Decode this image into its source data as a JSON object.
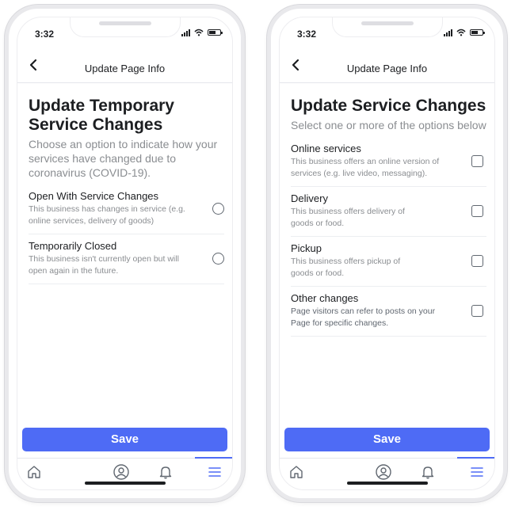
{
  "status": {
    "time": "3:32"
  },
  "header": {
    "title": "Update Page Info"
  },
  "left": {
    "title": "Update Temporary Service Changes",
    "subtitle": "Choose an option to indicate how your services have changed due to coronavirus (COVID-19).",
    "options": [
      {
        "title": "Open With Service Changes",
        "desc": "This business has changes in service (e.g. online services, delivery of goods)"
      },
      {
        "title": "Temporarily Closed",
        "desc": "This business isn't currently open but will open again in the future."
      }
    ]
  },
  "right": {
    "title": "Update Service Changes",
    "subtitle": "Select one or more of the options below",
    "options": [
      {
        "title": "Online services",
        "desc": "This business offers an online version of services (e.g. live video, messaging)."
      },
      {
        "title": "Delivery",
        "desc": "This business offers delivery of goods or food."
      },
      {
        "title": "Pickup",
        "desc": "This business offers pickup of goods or food."
      },
      {
        "title": "Other changes",
        "desc": "Page visitors can refer to posts on your Page for specific changes."
      }
    ]
  },
  "save_label": "Save",
  "tabs": [
    "home-icon",
    "profile-icon",
    "bell-icon",
    "menu-icon"
  ],
  "colors": {
    "accent": "#4e6bf5",
    "text": "#1c1e21",
    "muted": "#8a8d91"
  }
}
